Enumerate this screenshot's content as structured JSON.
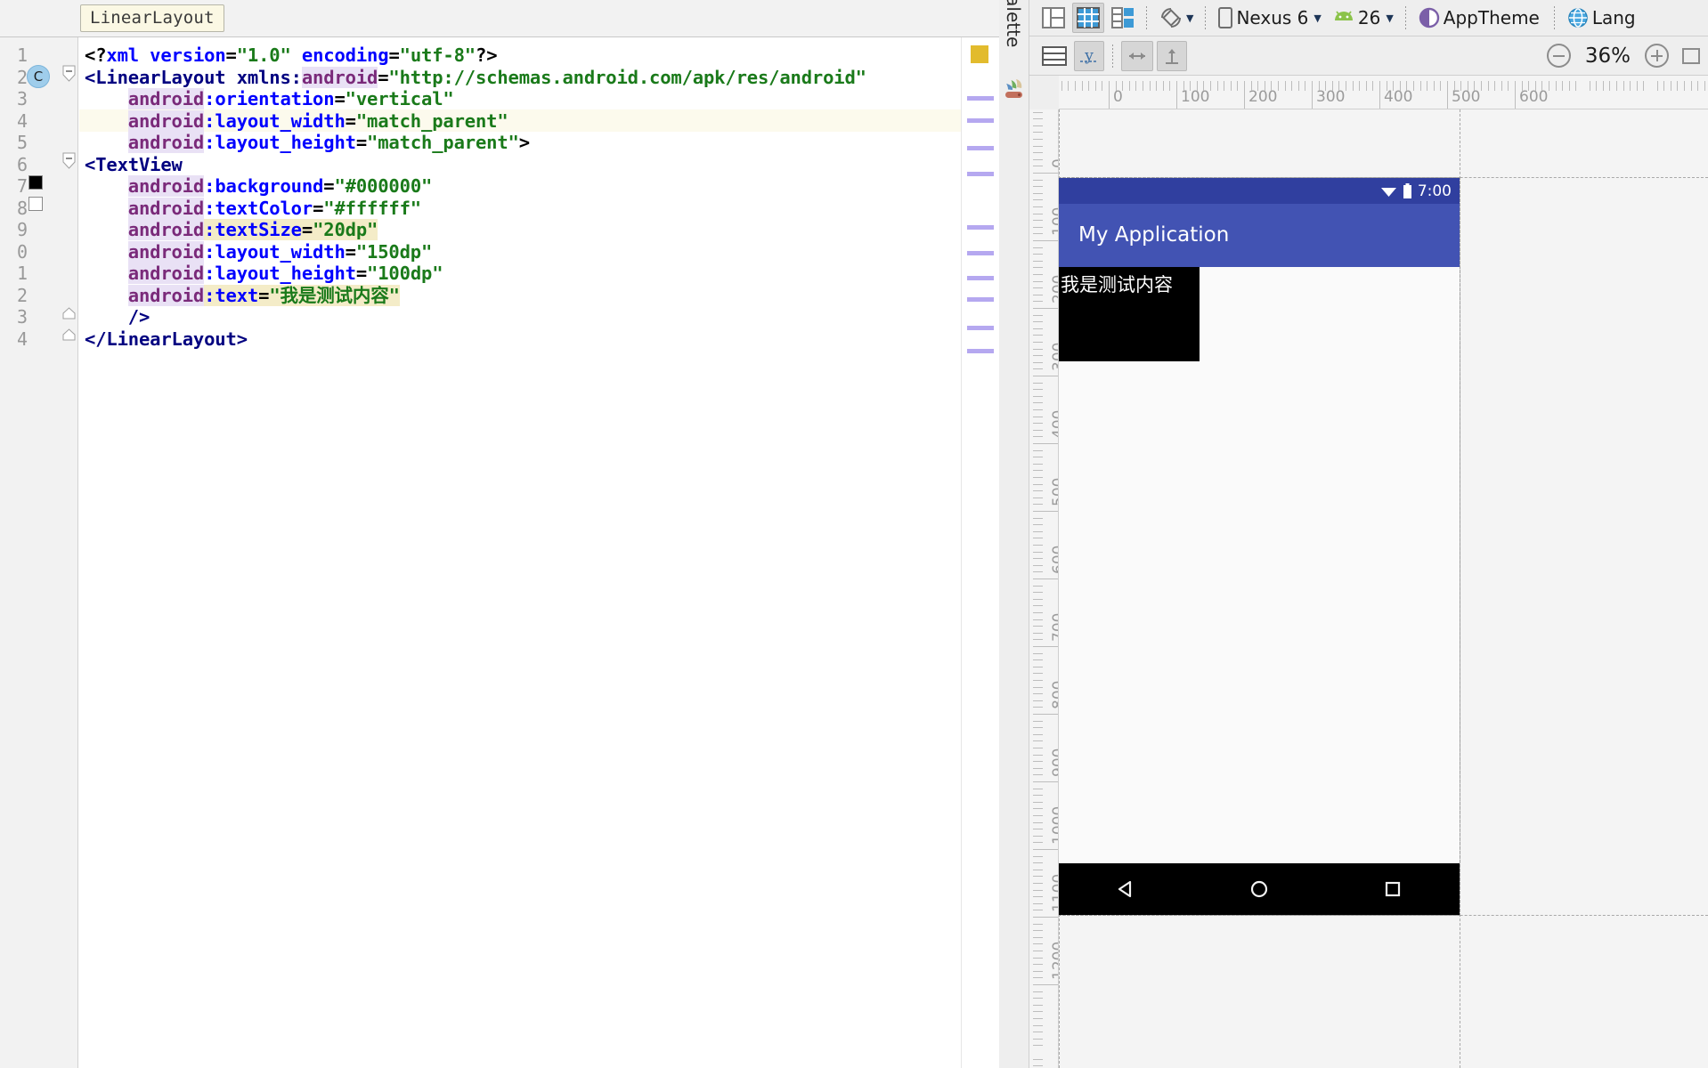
{
  "editor": {
    "breadcrumb_tag": "LinearLayout",
    "line_numbers": [
      "1",
      "2",
      "3",
      "4",
      "5",
      "6",
      "7",
      "8",
      "9",
      "0",
      "1",
      "2",
      "3",
      "4"
    ],
    "highlighted_line_index": 3,
    "gutter_icons": [
      {
        "name": "class-marker-icon",
        "label": "C",
        "line": 2
      },
      {
        "name": "color-swatch-black-icon",
        "color": "#000000",
        "line": 7
      },
      {
        "name": "color-swatch-white-icon",
        "color": "#ffffff",
        "line": 8
      }
    ],
    "code_lines": [
      "<?xml version=\"1.0\" encoding=\"utf-8\"?>",
      "<LinearLayout xmlns:android=\"http://schemas.android.com/apk/res/android\"",
      "    android:orientation=\"vertical\"",
      "    android:layout_width=\"match_parent\"",
      "    android:layout_height=\"match_parent\">",
      "<TextView",
      "    android:background=\"#000000\"",
      "    android:textColor=\"#ffffff\"",
      "    android:textSize=\"20dp\"",
      "    android:layout_width=\"150dp\"",
      "    android:layout_height=\"100dp\"",
      "    android:text=\"我是测试内容\"",
      "    />",
      "</LinearLayout>"
    ],
    "marker_rail": {
      "warning_color": "#e2bb2d",
      "stripe_color": "#b5a8f0",
      "stripe_count": 11
    }
  },
  "design": {
    "palette_label": "Palette",
    "toolbar_top": {
      "buttons": [
        {
          "name": "design-mode-button",
          "icon": "layout-design-icon"
        },
        {
          "name": "blueprint-mode-button",
          "icon": "blueprint-grid-icon",
          "active": true
        },
        {
          "name": "split-mode-button",
          "icon": "split-view-icon"
        },
        {
          "name": "orientation-button",
          "icon": "rotate-device-icon"
        }
      ],
      "device_label": "Nexus 6",
      "api_label": "26",
      "theme_label": "AppTheme",
      "locale_label": "Lang"
    },
    "toolbar_bottom": {
      "buttons": [
        {
          "name": "device-screen-button",
          "icon": "rows-layout-icon"
        },
        {
          "name": "baseline-button",
          "icon": "baseline-y-icon",
          "active": true
        },
        {
          "name": "horizontal-margin-button",
          "icon": "horizontal-arrows-icon",
          "disabled": true
        },
        {
          "name": "vertical-margin-button",
          "icon": "vertical-arrow-icon",
          "disabled": true
        }
      ],
      "zoom_out_label": "zoom-out",
      "zoom_level": "36%",
      "zoom_in_label": "zoom-in"
    },
    "ruler_h_labels": [
      "0",
      "100",
      "200",
      "300",
      "400",
      "500",
      "600"
    ],
    "ruler_v_labels": [
      "0",
      "100",
      "200",
      "300",
      "400",
      "500",
      "600",
      "700",
      "800",
      "900",
      "1000",
      "1100",
      "1200"
    ],
    "preview": {
      "status_time": "7:00",
      "app_title": "My Application",
      "textview_text": "我是测试内容",
      "status_bar_color": "#303f9f",
      "app_bar_color": "#4253b3",
      "textview_bg": "#000000",
      "textview_fg": "#ffffff",
      "nav_buttons": [
        "back-triangle",
        "home-circle",
        "recents-square"
      ]
    }
  }
}
